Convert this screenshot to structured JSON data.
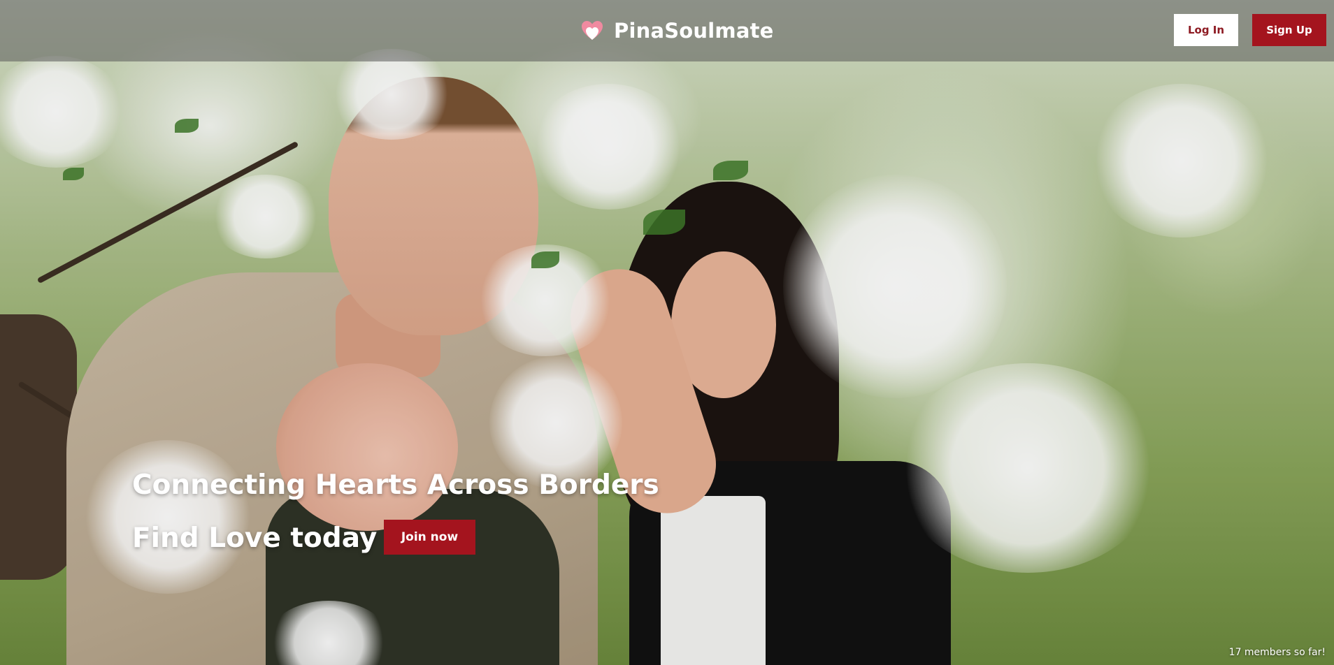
{
  "header": {
    "brand_name": "PinaSoulmate",
    "logo_icon": "heart-logo-icon",
    "login_label": "Log In",
    "signup_label": "Sign Up"
  },
  "hero": {
    "headline": "Connecting Hearts Across Borders",
    "subline": "Find Love today",
    "join_label": "Join now",
    "members_text": "17 members so far!"
  },
  "colors": {
    "brand_red": "#a4141e",
    "login_text": "#8d1a22",
    "header_overlay": "rgba(90,90,90,0.55)",
    "white": "#ffffff"
  }
}
